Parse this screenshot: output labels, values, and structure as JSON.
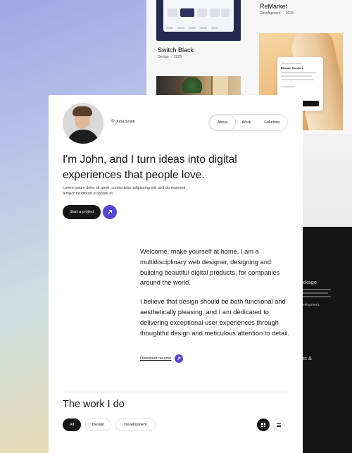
{
  "background": {
    "projects": [
      {
        "title": "Switch Black",
        "category": "Design",
        "year": "2023"
      },
      {
        "title": "ReMarket",
        "category": "Development",
        "year": "2023"
      }
    ],
    "remarket_card_title": "Blender Renders",
    "dark_panel": {
      "heading": "ckage",
      "link": "velopment.",
      "label": "ts &"
    }
  },
  "header": {
    "owner": "John Smith",
    "copyright_symbol": "©",
    "nav": [
      {
        "label": "About",
        "active": true
      },
      {
        "label": "Work",
        "active": false
      },
      {
        "label": "Solutions",
        "active": false
      }
    ]
  },
  "hero": {
    "headline": "I'm John, and I turn ideas into digital experiences that people love.",
    "subtext": "Lorem ipsum dolor sit amet, consectetur adipiscing elit, sed do eiusmod tempor incididunt ut labore et.",
    "cta_label": "Start a project",
    "cta_icon": "arrow-up-right-icon"
  },
  "intro": {
    "paragraph1": "Welcome, make yourself at home. I am a multidisciplinary web designer, designing and building beautiful digital products, for companies around the world.",
    "paragraph2": "I believe that design should be both functional and aesthetically pleasing, and I am dedicated to delivering exceptional user experiences through thoughtful design and meticulous attention to detail.",
    "resume_label": "Download resume"
  },
  "work": {
    "heading": "The work I do",
    "filters": [
      {
        "label": "All",
        "active": true
      },
      {
        "label": "Design",
        "active": false
      },
      {
        "label": "Development",
        "active": false
      }
    ],
    "view_modes": [
      "grid-icon",
      "list-icon"
    ]
  },
  "colors": {
    "accent": "#5546d8",
    "dark": "#171717",
    "card_bg": "#ffffff"
  }
}
